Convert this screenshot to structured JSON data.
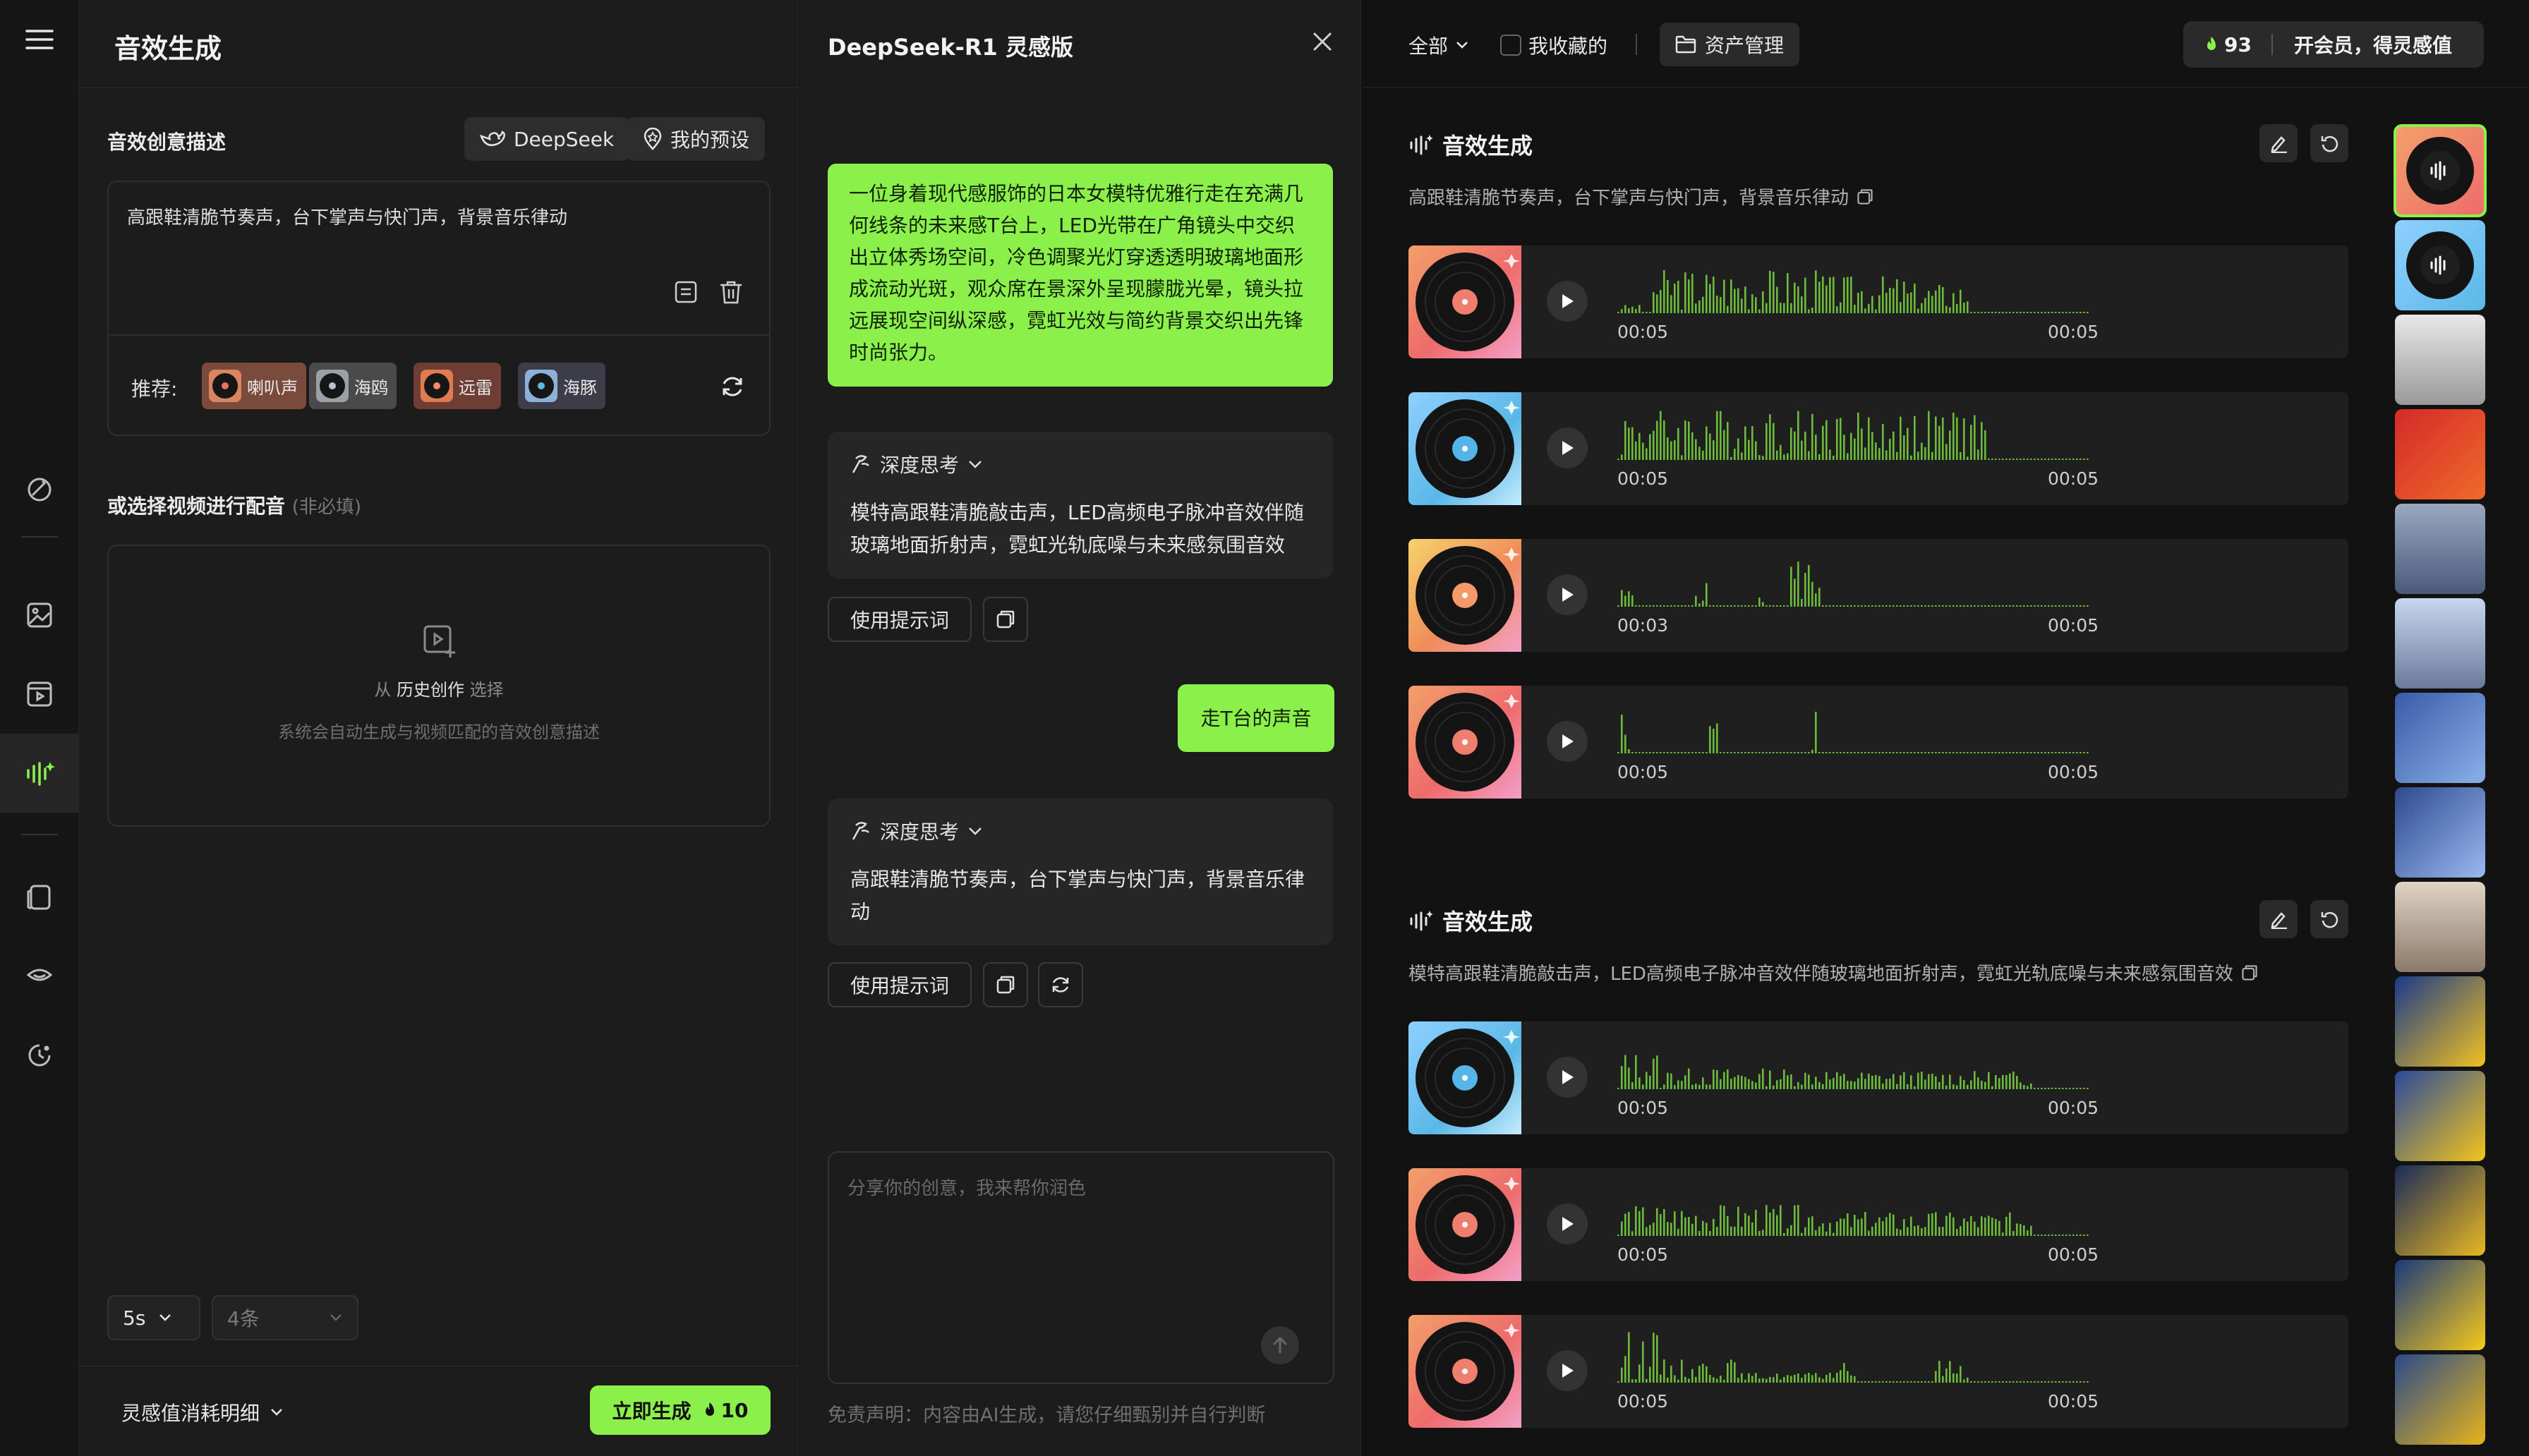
{
  "panel1": {
    "title": "音效生成",
    "creative_label": "音效创意描述",
    "deepseek_label": "DeepSeek",
    "preset_label": "我的预设",
    "prompt_text": "高跟鞋清脆节奏声，台下掌声与快门声，背景音乐律动",
    "recommend_label": "推荐:",
    "recommend_chips": [
      "喇叭声",
      "海鸥",
      "远雷",
      "海豚"
    ],
    "video_label": "或选择视频进行配音",
    "video_optional": "(非必填)",
    "video_from": "从",
    "video_history": "历史创作",
    "video_select": "选择",
    "video_hint": "系统会自动生成与视频匹配的音效创意描述",
    "duration_value": "5s",
    "count_value": "4条",
    "cost_detail": "灵感值消耗明细",
    "generate_label": "立即生成",
    "generate_cost": "10"
  },
  "panel2": {
    "title": "DeepSeek-R1 灵感版",
    "user_long_message": "一位身着现代感服饰的日本女模特优雅行走在充满几何线条的未来感T台上，LED光带在广角镜头中交织出立体秀场空间，冷色调聚光灯穿透透明玻璃地面形成流动光斑，观众席在景深外呈现朦胧光晕，镜头拉远展现空间纵深感，霓虹光效与简约背景交织出先锋时尚张力。",
    "think1_label": "深度思考",
    "think1_text": "模特高跟鞋清脆敲击声，LED高频电子脉冲音效伴随玻璃地面折射声，霓虹光轨底噪与未来感氛围音效",
    "use_prompt_label": "使用提示词",
    "user_short_message": "走T台的声音",
    "think2_label": "深度思考",
    "think2_text": "高跟鞋清脆节奏声，台下掌声与快门声，背景音乐律动",
    "use_prompt_label2": "使用提示词",
    "input_placeholder": "分享你的创意，我来帮你润色",
    "disclaimer": "免责声明：内容由AI生成，请您仔细甄别并自行判断"
  },
  "panel3": {
    "filter_all": "全部",
    "favorites": "我收藏的",
    "assets": "资产管理",
    "points": "93",
    "membership": "开会员，得灵感值",
    "groups": [
      {
        "title": "音效生成",
        "desc": "高跟鞋清脆节奏声，台下掌声与快门声，背景音乐律动",
        "tracks": [
          {
            "start": "00:05",
            "end": "00:05",
            "cover": "pink"
          },
          {
            "start": "00:05",
            "end": "00:05",
            "cover": "blue"
          },
          {
            "start": "00:03",
            "end": "00:05",
            "cover": "orange"
          },
          {
            "start": "00:05",
            "end": "00:05",
            "cover": "pink"
          }
        ]
      },
      {
        "title": "音效生成",
        "desc": "模特高跟鞋清脆敲击声，LED高频电子脉冲音效伴随玻璃地面折射声，霓虹光轨底噪与未来感氛围音效",
        "tracks": [
          {
            "start": "00:05",
            "end": "00:05",
            "cover": "blue"
          },
          {
            "start": "00:05",
            "end": "00:05",
            "cover": "pink"
          },
          {
            "start": "00:05",
            "end": "00:05",
            "cover": "pink"
          }
        ]
      }
    ]
  },
  "colors": {
    "accent": "#8cf04b",
    "bg": "#121212",
    "panel": "#1c1c1c"
  }
}
